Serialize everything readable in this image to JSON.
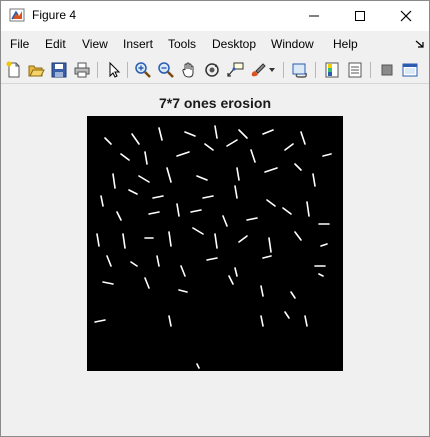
{
  "window": {
    "title": "Figure 4"
  },
  "menu": {
    "items": [
      {
        "label": "File"
      },
      {
        "label": "Edit"
      },
      {
        "label": "View"
      },
      {
        "label": "Insert"
      },
      {
        "label": "Tools"
      },
      {
        "label": "Desktop"
      },
      {
        "label": "Window"
      },
      {
        "label": "Help"
      }
    ]
  },
  "toolbar": {
    "icons": [
      "new-figure-icon",
      "open-file-icon",
      "save-icon",
      "print-icon",
      "pointer-icon",
      "zoom-in-icon",
      "zoom-out-icon",
      "pan-icon",
      "rotate-3d-icon",
      "data-cursor-icon",
      "brush-icon",
      "link-plot-icon",
      "colorbar-icon",
      "legend-icon",
      "hide-plot-tools-icon",
      "show-plot-tools-icon"
    ]
  },
  "figure": {
    "title": "7*7 ones erosion",
    "image_background": "#000000",
    "image_foreground": "#ffffff"
  }
}
